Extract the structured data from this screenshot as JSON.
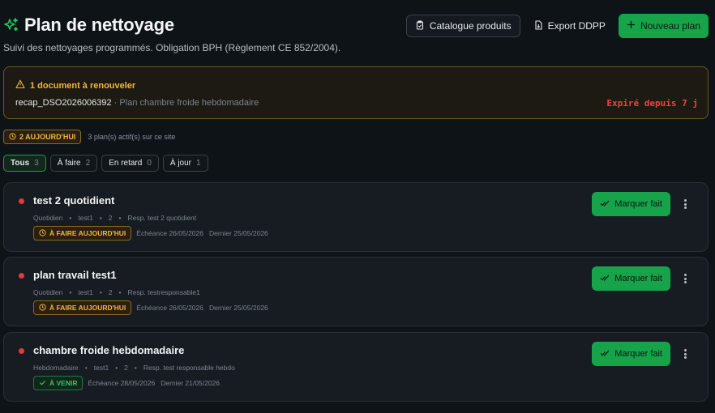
{
  "header": {
    "title": "Plan de nettoyage",
    "subtitle": "Suivi des nettoyages programmés. Obligation BPH (Règlement CE 852/2004).",
    "catalog_label": "Catalogue produits",
    "export_label": "Export DDPP",
    "new_plan_label": "Nouveau plan"
  },
  "alert": {
    "title": "1 document à renouveler",
    "doc_name": "recap_DSO2026006392",
    "doc_desc": " · Plan chambre froide hebdomadaire",
    "expired_label": "Expiré depuis 7 j"
  },
  "summary": {
    "today_badge": "2 AUJOURD'HUI",
    "active_count": "3 plan(s) actif(s) sur ce site"
  },
  "filters": [
    {
      "label": "Tous",
      "count": "3"
    },
    {
      "label": "À faire",
      "count": "2"
    },
    {
      "label": "En retard",
      "count": "0"
    },
    {
      "label": "À jour",
      "count": "1"
    }
  ],
  "plans": [
    {
      "title": "test 2 quotidient",
      "frequency": "Quotidien",
      "site": "test1",
      "number": "2",
      "responsible": "Resp. test 2 quotidient",
      "status": "À FAIRE AUJOURD'HUI",
      "due": "Échéance 26/05/2026",
      "last": "Dernier 25/05/2026",
      "action": "Marquer fait"
    },
    {
      "title": "plan travail test1",
      "frequency": "Quotidien",
      "site": "test1",
      "number": "2",
      "responsible": "Resp. testresponsable1",
      "status": "À FAIRE AUJOURD'HUI",
      "due": "Échéance 26/05/2026",
      "last": "Dernier 25/05/2026",
      "action": "Marquer fait"
    },
    {
      "title": "chambre froide hebdomadaire",
      "frequency": "Hebdomadaire",
      "site": "test1",
      "number": "2",
      "responsible": "Resp. test responsable hebdo",
      "status": "À VENIR",
      "due": "Échéance 28/05/2026",
      "last": "Dernier 21/05/2026",
      "action": "Marquer fait"
    }
  ],
  "colors": {
    "accent_green": "#16a34a",
    "warning": "#f4b43f",
    "danger": "#ef4444"
  }
}
